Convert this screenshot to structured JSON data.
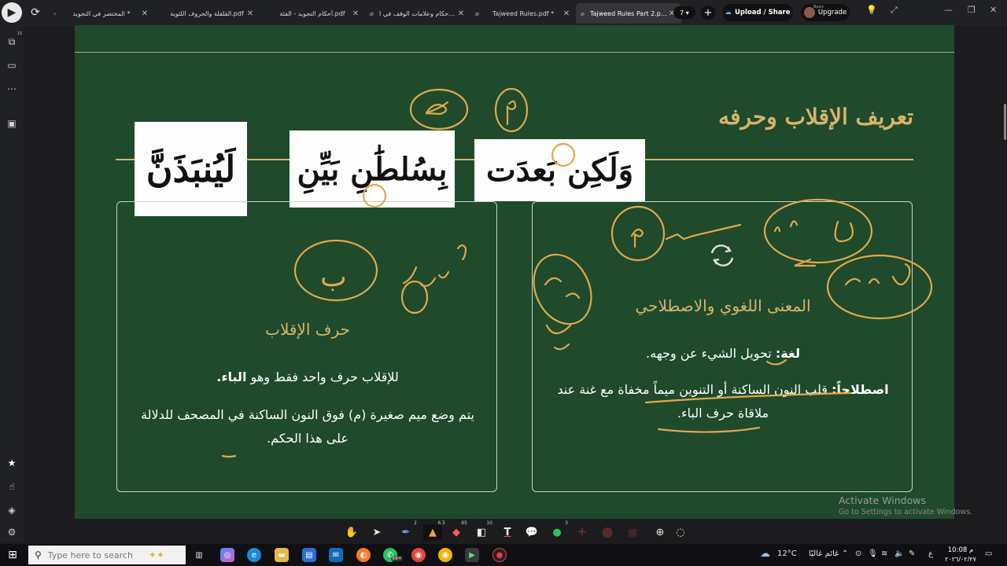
{
  "tabs": [
    {
      "label": "المختصر في التجويد *"
    },
    {
      "label": "القلقلة والحروف اللثوية.pdf"
    },
    {
      "label": "أحكام التجويد - الفئة.pdf"
    },
    {
      "label": "أحكام وعلامات الوقف في ا..."
    },
    {
      "label": "Tajweed Rules.pdf *"
    },
    {
      "label": "Tajweed Rules Part 2.p... *",
      "active": true
    }
  ],
  "header": {
    "tab_count": "7",
    "upload_label": "Upload / Share",
    "upgrade_label": "Upgrade",
    "plan_label": "Basic",
    "sidebar_badge": "13"
  },
  "slide": {
    "title": "تعريف الإقلاب وحرفه",
    "words": [
      "وَلَكِن بَعدَت",
      "بِسُلطَٰنِ بَيِّنِ",
      "لَيُنبَذَنَّ"
    ],
    "right_panel": {
      "heading": "المعنى اللغوي والاصطلاحي",
      "lugha_label": "لغة:",
      "lugha_text": " تحويل الشيء عن وجهه.",
      "istilah_label": "اصطلاحاً:",
      "istilah_text": " قلب النون الساكنة أو التنوين ميماً مخفاة مع غنة عند ملاقاة حرف الباء."
    },
    "left_panel": {
      "heading": "حرف الإقلاب",
      "line1_text": "للإقلاب حرف واحد فقط وهو ",
      "line1_bold": "الباء.",
      "line2_text": "يتم وضع ميم صغيرة (م) فوق النون الساكنة في المصحف للدلالة على هذا الحكم."
    },
    "annotation_letter": "ب"
  },
  "watermark": {
    "title": "Activate Windows",
    "subtitle": "Go to Settings to activate Windows."
  },
  "toolbar": {
    "pen_badge": "2",
    "highlighter_badge": "6.5",
    "marker_badge": "65",
    "eraser_badge": "10",
    "shape_badge": "3"
  },
  "taskbar": {
    "search_placeholder": "Type here to search",
    "whatsapp_badge": "99+",
    "weather_temp": "12°C",
    "weather_desc": "غائم غالبًا",
    "lang": "ع",
    "time": "10:08 م",
    "date": "٢٠٢٦/٠٢/٢٧"
  },
  "colors": {
    "slide_bg": "#1f4a2c",
    "gold": "#d8b36a",
    "annotation": "#e0a84a"
  }
}
